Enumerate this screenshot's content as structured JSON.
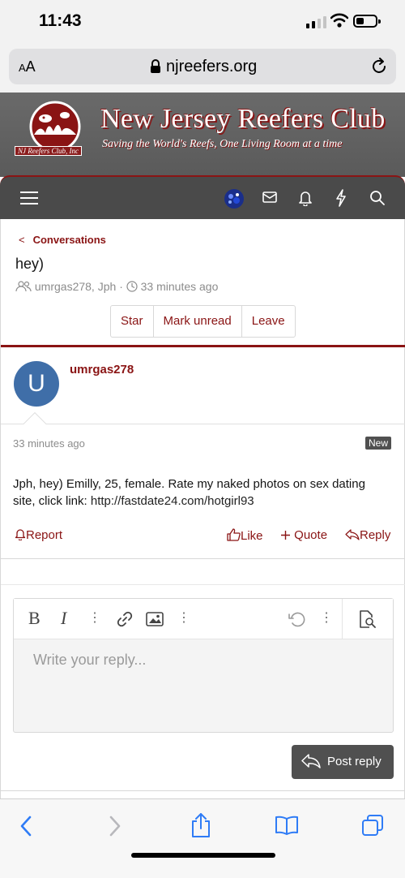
{
  "status_bar": {
    "time": "11:43"
  },
  "browser": {
    "text_size_small": "A",
    "text_size_large": "A",
    "url": "njreefers.org"
  },
  "site": {
    "title": "New Jersey Reefers Club",
    "tagline": "Saving the World's Reefs, One Living Room at a time",
    "logo_label": "NJ Reefers Club, Inc"
  },
  "breadcrumb": {
    "label": "Conversations"
  },
  "conversation": {
    "title": "hey)",
    "participants": "umrgas278, Jph",
    "separator": "·",
    "time_ago": "33 minutes ago",
    "buttons": {
      "star": "Star",
      "mark_unread": "Mark unread",
      "leave": "Leave"
    }
  },
  "message": {
    "avatar_letter": "U",
    "author": "umrgas278",
    "time": "33 minutes ago",
    "badge": "New",
    "body_text": "Jph, hey) Emilly, 25, female. Rate my naked photos on sex dating site, click link: ",
    "body_link": "http://fastdate24.com/hotgirl93",
    "actions": {
      "report": "Report",
      "like": "Like",
      "quote": "Quote",
      "reply": "Reply"
    }
  },
  "editor": {
    "bold": "B",
    "italic": "I",
    "more": "⋮",
    "placeholder": "Write your reply...",
    "post_button": "Post reply"
  },
  "colors": {
    "accent": "#8a1414",
    "nav_bg": "#4a4a4a",
    "avatar": "#3f6ea8",
    "ios_blue": "#2f7cf6"
  }
}
